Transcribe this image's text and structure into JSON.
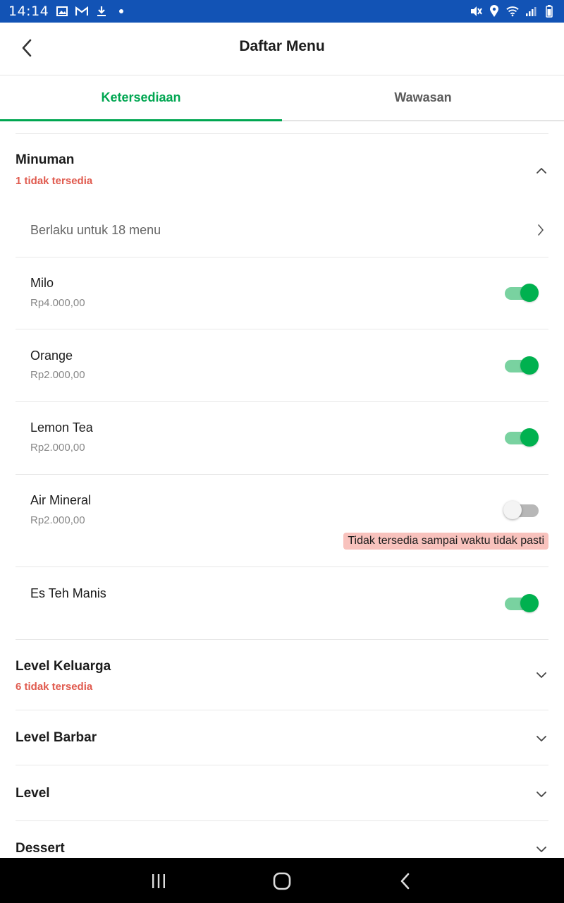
{
  "status_bar": {
    "time": "14:14"
  },
  "header": {
    "title": "Daftar Menu",
    "back_icon": "chevron-left-icon"
  },
  "tabs": [
    {
      "label": "Ketersediaan",
      "active": true
    },
    {
      "label": "Wawasan",
      "active": false
    }
  ],
  "category_expanded": {
    "name": "Minuman",
    "unavailable_text": "1 tidak tersedia",
    "apply_text": "Berlaku untuk 18 menu",
    "items": [
      {
        "name": "Milo",
        "price": "Rp4.000,00",
        "available": true
      },
      {
        "name": "Orange",
        "price": "Rp2.000,00",
        "available": true
      },
      {
        "name": "Lemon Tea",
        "price": "Rp2.000,00",
        "available": true
      },
      {
        "name": "Air Mineral",
        "price": "Rp2.000,00",
        "available": false,
        "badge": "Tidak tersedia sampai waktu tidak pasti"
      },
      {
        "name": "Es Teh Manis",
        "price": "",
        "available": true
      }
    ]
  },
  "categories": [
    {
      "name": "Level Keluarga",
      "unavailable_text": "6 tidak tersedia"
    },
    {
      "name": "Level Barbar",
      "unavailable_text": ""
    },
    {
      "name": "Level",
      "unavailable_text": ""
    },
    {
      "name": "Dessert",
      "unavailable_text": ""
    }
  ],
  "colors": {
    "accent": "#00a651",
    "status_bar": "#1253b5",
    "warning": "#e05a4e",
    "badge_bg": "#f8c2bd"
  }
}
